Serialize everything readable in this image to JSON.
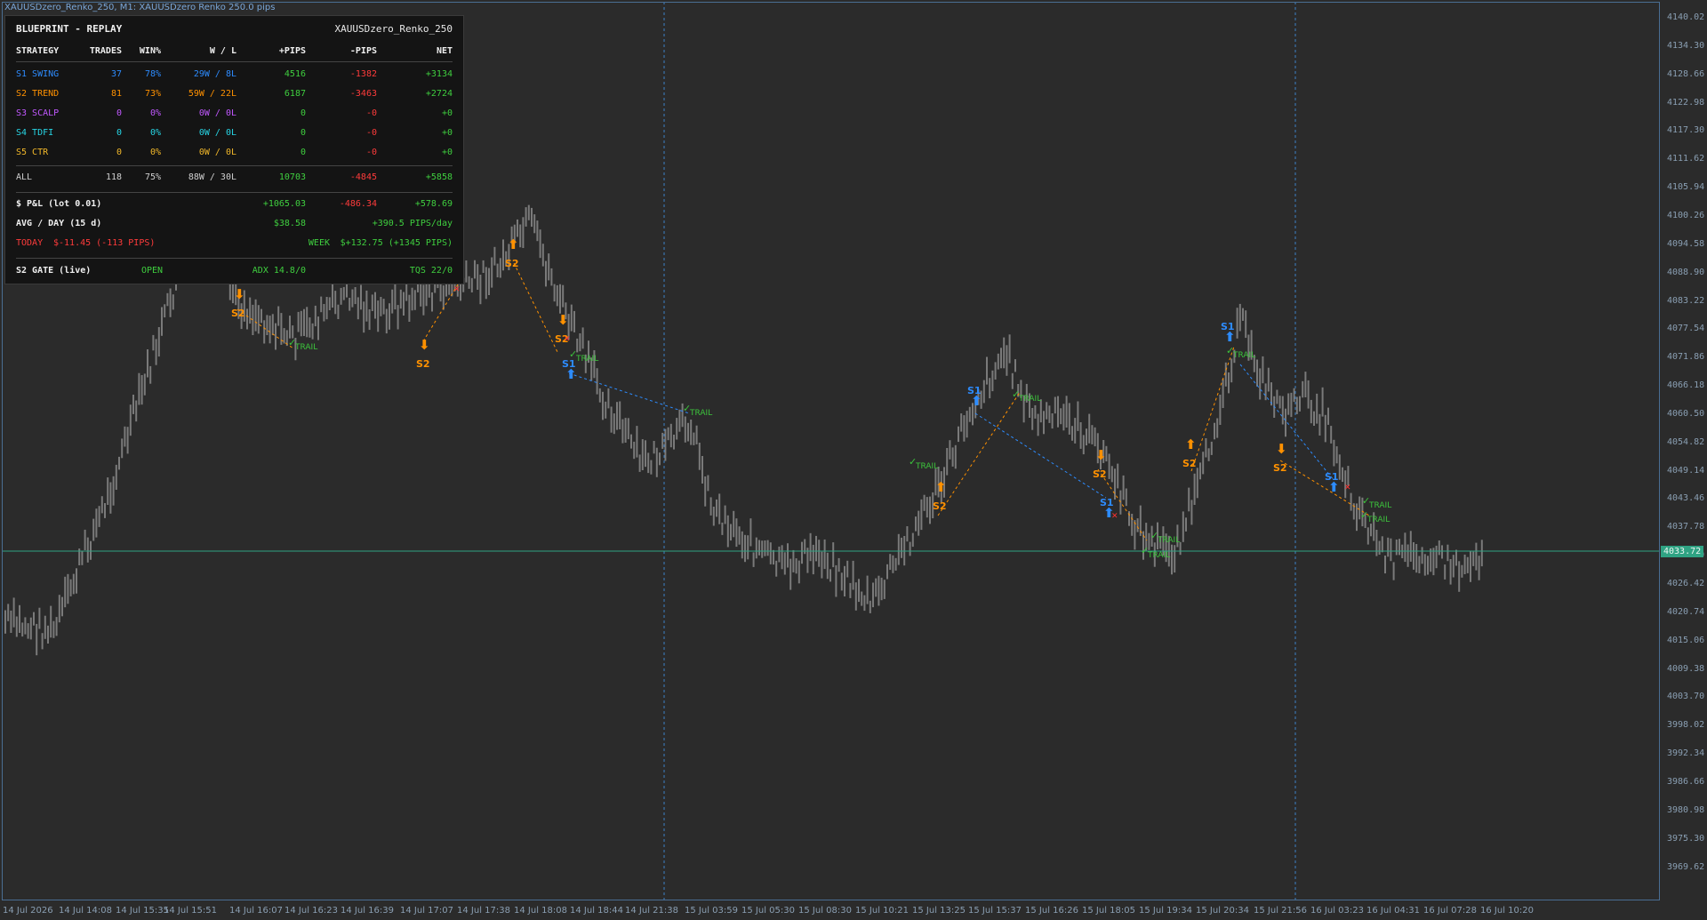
{
  "window": {
    "title": "XAUUSDzero_Renko_250, M1:  XAUUSDzero Renko 250.0 pips"
  },
  "colors": {
    "background": "#2b2b2b",
    "candle": "#7a7a7a",
    "s1": "#2d8cff",
    "s2": "#ff9100",
    "s3": "#c158ff",
    "s4": "#27d6e6",
    "s5": "#f2b82a",
    "profit": "#3fcf3f",
    "loss": "#ff3b3b",
    "price_line": "#2fa383"
  },
  "panel": {
    "title": "BLUEPRINT - REPLAY",
    "symbol": "XAUUSDzero_Renko_250",
    "headers": [
      "STRATEGY",
      "TRADES",
      "WIN%",
      "W / L",
      "+PIPS",
      "-PIPS",
      "NET"
    ],
    "strategies": [
      {
        "name": "S1 SWING",
        "trades": "37",
        "win": "78%",
        "wl": "29W / 8L",
        "plus": "4516",
        "minus": "-1382",
        "net": "+3134"
      },
      {
        "name": "S2 TREND",
        "trades": "81",
        "win": "73%",
        "wl": "59W / 22L",
        "plus": "6187",
        "minus": "-3463",
        "net": "+2724"
      },
      {
        "name": "S3 SCALP",
        "trades": "0",
        "win": "0%",
        "wl": "0W / 0L",
        "plus": "0",
        "minus": "-0",
        "net": "+0"
      },
      {
        "name": "S4 TDFI",
        "trades": "0",
        "win": "0%",
        "wl": "0W / 0L",
        "plus": "0",
        "minus": "-0",
        "net": "+0"
      },
      {
        "name": "S5 CTR",
        "trades": "0",
        "win": "0%",
        "wl": "0W / 0L",
        "plus": "0",
        "minus": "-0",
        "net": "+0"
      }
    ],
    "all": {
      "name": "ALL",
      "trades": "118",
      "win": "75%",
      "wl": "88W / 30L",
      "plus": "10703",
      "minus": "-4845",
      "net": "+5858"
    },
    "pnl": {
      "label": "$ P&L (lot 0.01)",
      "plus": "+1065.03",
      "minus": "-486.34",
      "net": "+578.69"
    },
    "avg": {
      "label": "AVG / DAY (15 d)",
      "value": "$38.58",
      "pips": "+390.5 PIPS/day"
    },
    "today": {
      "label": "TODAY",
      "value": "$-11.45 (-113 PIPS)"
    },
    "week": {
      "label": "WEEK",
      "value": "$+132.75 (+1345 PIPS)"
    },
    "gate": {
      "label": "S2 GATE (live)",
      "status": "OPEN",
      "adx": "ADX 14.8/0",
      "tqs": "TQS 22/0"
    }
  },
  "price_axis": [
    "4140.02",
    "4134.30",
    "4128.66",
    "4122.98",
    "4117.30",
    "4111.62",
    "4105.94",
    "4100.26",
    "4094.58",
    "4088.90",
    "4083.22",
    "4077.54",
    "4071.86",
    "4066.18",
    "4060.50",
    "4054.82",
    "4049.14",
    "4043.46",
    "4037.78",
    "4032.10",
    "4026.42",
    "4020.74",
    "4015.06",
    "4009.38",
    "4003.70",
    "3998.02",
    "3992.34",
    "3986.66",
    "3980.98",
    "3975.30",
    "3969.62"
  ],
  "current_price": "4033.72",
  "time_axis": [
    "14 Jul 2026",
    "14 Jul 14:08",
    "14 Jul 15:35",
    "14 Jul 15:51",
    "14 Jul 16:07",
    "14 Jul 16:23",
    "14 Jul 16:39",
    "14 Jul 17:07",
    "14 Jul 17:38",
    "14 Jul 18:08",
    "14 Jul 18:44",
    "14 Jul 21:38",
    "15 Jul 03:59",
    "15 Jul 05:30",
    "15 Jul 08:30",
    "15 Jul 10:21",
    "15 Jul 13:25",
    "15 Jul 15:37",
    "15 Jul 16:26",
    "15 Jul 18:05",
    "15 Jul 19:34",
    "15 Jul 20:34",
    "15 Jul 21:56",
    "16 Jul 03:23",
    "16 Jul 04:31",
    "16 Jul 07:28",
    "16 Jul 10:20"
  ],
  "markers": {
    "s2": "S2",
    "s1": "S1",
    "trail": "TRAIL",
    "trail_marker_count": 12,
    "s1_marker_count": 7,
    "s2_marker_count": 9
  }
}
